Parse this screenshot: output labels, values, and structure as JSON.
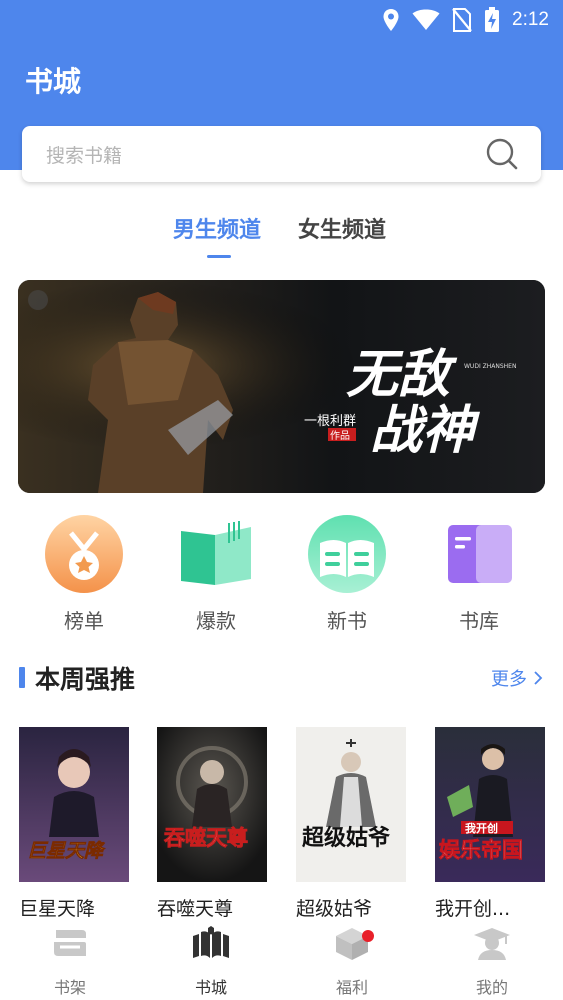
{
  "status_bar": {
    "time": "2:12",
    "icons": [
      "location-icon",
      "wifi-icon",
      "no-sim-icon",
      "battery-charging-icon"
    ]
  },
  "header": {
    "title": "书城"
  },
  "search": {
    "placeholder": "搜索书籍",
    "icon": "search-icon"
  },
  "tabs": [
    {
      "label": "男生频道",
      "active": true
    },
    {
      "label": "女生频道",
      "active": false
    }
  ],
  "banner": {
    "title": "无敌战神",
    "pinyin": "WUDI ZHANSHEN",
    "author": "一根利群",
    "author_suffix": "作品"
  },
  "categories": [
    {
      "label": "榜单",
      "icon": "medal-icon"
    },
    {
      "label": "爆款",
      "icon": "open-book-icon"
    },
    {
      "label": "新书",
      "icon": "new-book-icon"
    },
    {
      "label": "书库",
      "icon": "library-icon"
    }
  ],
  "weekly": {
    "title": "本周强推",
    "more": "更多",
    "books": [
      {
        "title": "巨星天降",
        "cover_text": "巨星天降"
      },
      {
        "title": "吞噬天尊",
        "cover_text": "吞噬天尊"
      },
      {
        "title": "超级姑爷",
        "cover_text": "超级姑爷"
      },
      {
        "title": "我开创...",
        "cover_text": "娱乐帝国",
        "cover_subtitle": "我开创"
      }
    ]
  },
  "bottom_nav": [
    {
      "label": "书架",
      "icon": "bookshelf-icon",
      "active": false
    },
    {
      "label": "书城",
      "icon": "bookstore-icon",
      "active": true
    },
    {
      "label": "福利",
      "icon": "gift-box-icon",
      "active": false,
      "badge": true
    },
    {
      "label": "我的",
      "icon": "profile-icon",
      "active": false
    }
  ],
  "colors": {
    "primary": "#4e86ec",
    "badge": "#e8202a",
    "medal": "#f5a25a",
    "green": "#3fcf9b",
    "purple": "#9b6cf0"
  }
}
